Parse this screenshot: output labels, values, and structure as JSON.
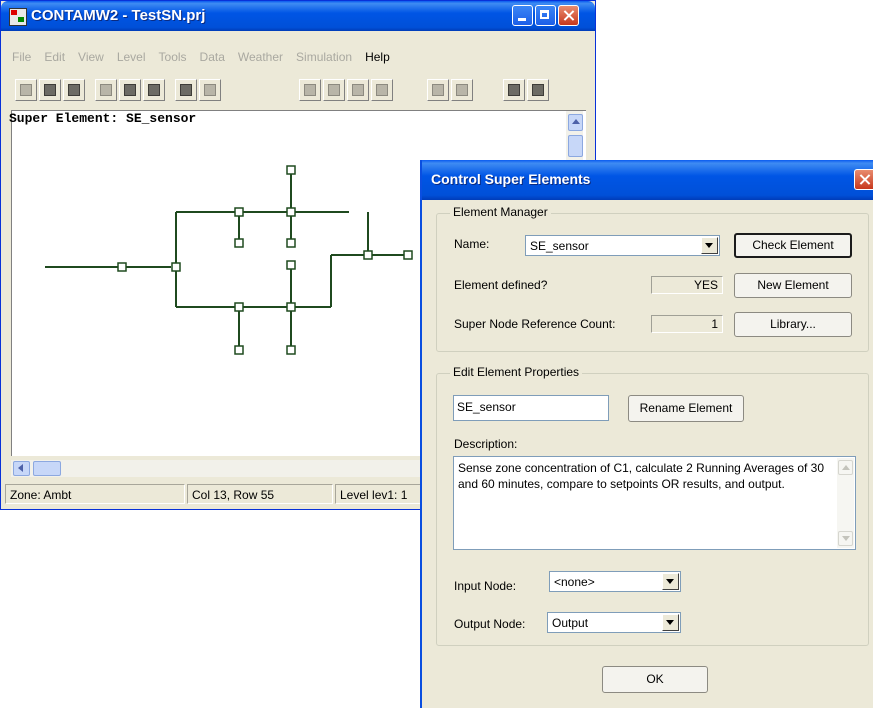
{
  "main_window": {
    "title": "CONTAMW2 - TestSN.prj",
    "menu": [
      "File",
      "Edit",
      "View",
      "Level",
      "Tools",
      "Data",
      "Weather",
      "Simulation",
      "Help"
    ],
    "menu_enabled": "Help",
    "toolbar_icons": [
      "new-icon",
      "open-icon",
      "save-icon",
      "cut-icon",
      "copy-icon",
      "paste-icon",
      "find-icon",
      "replace-icon",
      "line-icon",
      "rectangle-icon",
      "diagonal-icon",
      "arrow-icon",
      "level-up-icon",
      "level-down-icon",
      "super-node-icon",
      "super-node-ref-icon"
    ],
    "canvas_title": "Super Element: SE_sensor",
    "status": {
      "zone": "Zone: Ambt",
      "position": "Col 13, Row 55",
      "level": "Level lev1: 1"
    }
  },
  "dialog": {
    "title": "Control Super Elements",
    "manager": {
      "group_label": "Element Manager",
      "name_label": "Name:",
      "name_value": "SE_sensor",
      "defined_label": "Element defined?",
      "defined_value": "YES",
      "refcount_label": "Super Node Reference Count:",
      "refcount_value": "1",
      "check_button": "Check Element",
      "new_button": "New Element",
      "library_button": "Library..."
    },
    "properties": {
      "group_label": "Edit Element Properties",
      "name_input": "SE_sensor",
      "rename_button": "Rename Element",
      "description_label": "Description:",
      "description": "Sense zone concentration of C1, calculate 2 Running Averages of 30 and 60 minutes, compare to setpoints OR results, and output.",
      "input_node_label": "Input Node:",
      "input_node_value": "<none>",
      "output_node_label": "Output Node:",
      "output_node_value": "Output"
    },
    "ok_button": "OK"
  },
  "colors": {
    "xp_blue": "#0055e5",
    "window_bg": "#ece9d8",
    "network_line": "#1f4a1f"
  }
}
